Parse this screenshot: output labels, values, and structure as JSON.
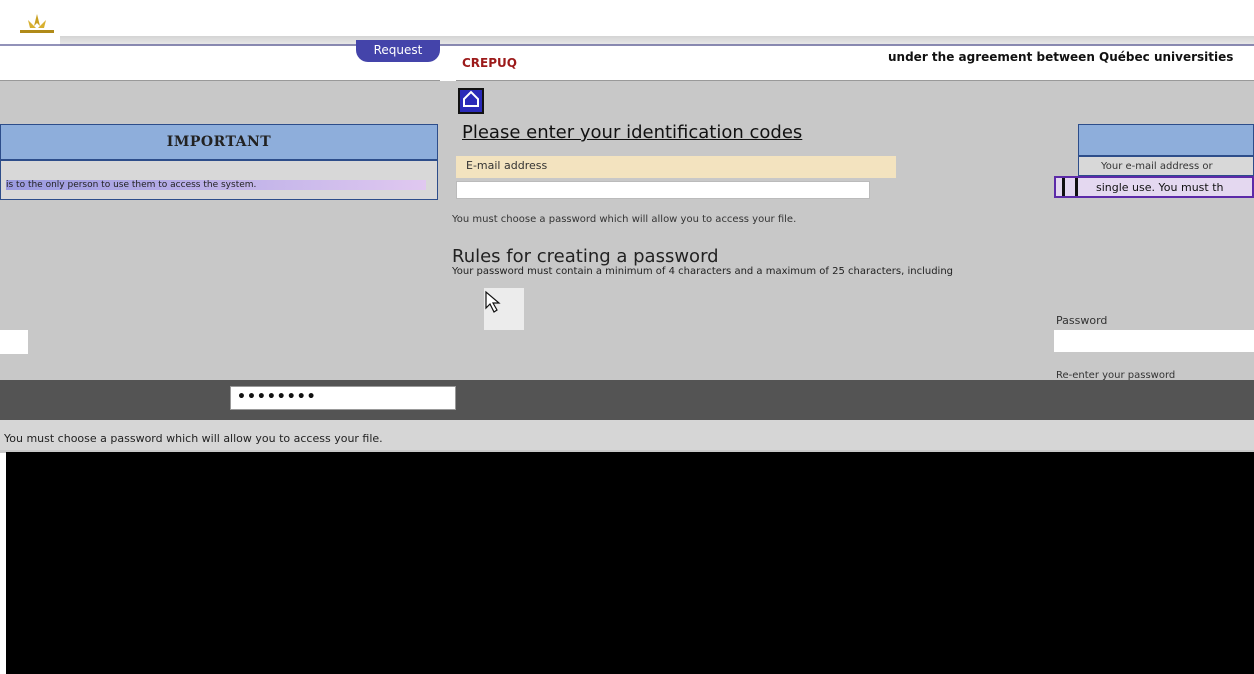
{
  "header": {
    "request_label": "Request",
    "org_name": "CREPUQ",
    "agreement_text": "under the agreement between Québec universities"
  },
  "left_panel": {
    "heading": "IMPORTANT",
    "line": "is to the only person to use them to access the system."
  },
  "main": {
    "title": "Please enter your identification codes",
    "email_label": "E-mail address",
    "choose_text": "You must choose a password which will allow you to access your file.",
    "rules_title": "Rules for creating a password",
    "rules_text": "Your password must contain a minimum of 4 characters and a maximum of 25 characters, including"
  },
  "right_panel": {
    "body_text": "Your e-mail address or",
    "single_text": "single use. You must th",
    "password_label": "Password",
    "reenter_label": "Re-enter your password"
  },
  "password_value": "••••••••",
  "colors": {
    "panel_head": "#8eaedb",
    "brand_dark_red": "#9c1a1a",
    "accent_blue": "#2a2ab8"
  },
  "icons": {
    "home": "home-icon",
    "logo": "logo-icon",
    "cursor": "arrow-cursor-icon"
  }
}
